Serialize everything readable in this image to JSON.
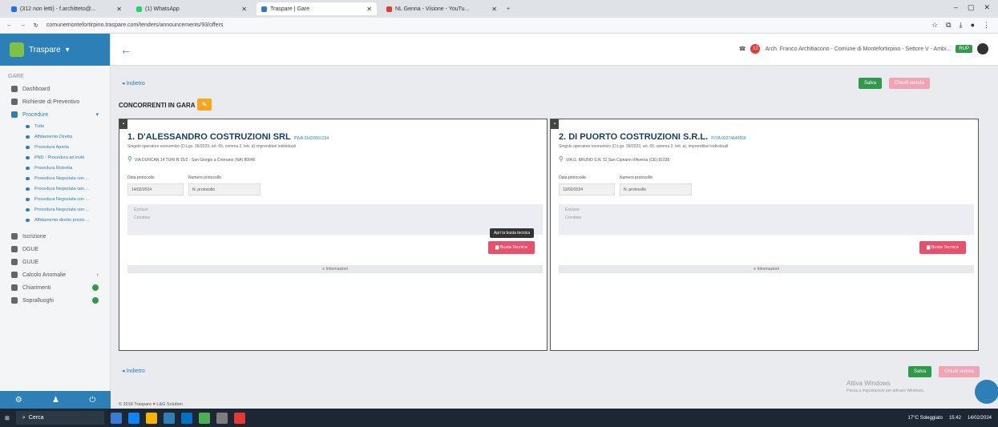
{
  "browser": {
    "tabs": [
      {
        "title": "(312 non letti) - f.architteto@..."
      },
      {
        "title": "(1) WhatsApp"
      },
      {
        "title": "Traspare | Gare"
      },
      {
        "title": "NL Genna - Visione - YouTu..."
      }
    ],
    "url": "comunemontefortirpino.traspare.com/tenders/announcements/93/offers",
    "window_controls": [
      "–",
      "▢",
      "✕"
    ]
  },
  "sidebar": {
    "brand": "Traspare",
    "section_label": "GARE",
    "items": [
      {
        "label": "Dashboard",
        "icon": "dashboard-icon"
      },
      {
        "label": "Richieste di Preventivo",
        "icon": "send-icon"
      },
      {
        "label": "Procedure",
        "icon": "procedure-icon",
        "open": true
      }
    ],
    "sub_items": [
      "Tutte",
      "Affidamento Diretto",
      "Procedura Aperta",
      "PND - Procedura ad inviti",
      "Procedura Ristretta",
      "Procedura Negoziata con ...",
      "Procedura Negoziata con ...",
      "Procedura Negoziata con ...",
      "Procedura Negoziata con ...",
      "Affidamento diretto previo ..."
    ],
    "items_lower": [
      {
        "label": "Iscrizione",
        "icon": "gear-icon"
      },
      {
        "label": "DGUE",
        "icon": "document-icon"
      },
      {
        "label": "GUUE",
        "icon": "megaphone-icon"
      },
      {
        "label": "Calcolo Anomalie",
        "icon": "calculator-icon",
        "arrow": "›"
      },
      {
        "label": "Chiarimenti",
        "icon": "info-icon",
        "badge": true
      },
      {
        "label": "Sopralluoghi",
        "icon": "eye-icon",
        "badge": true
      }
    ]
  },
  "topbar": {
    "notifications": "12",
    "user_info": "Arch. Franco Architiacono - Comune di Montefortirpino - Settore V - Ambi...",
    "role": "RUP"
  },
  "main": {
    "back_label": "◂ Indietro",
    "save_label": "Salva",
    "close_label": "Chiudi seduta",
    "section_title": "CONCORRENTI IN GARA",
    "footer_text": "© 2018 Traspare",
    "footer_suffix": "L&G Solution"
  },
  "competitors": [
    {
      "name": "1. D'ALESSANDRO COSTRUZIONI SRL",
      "piva": "P.IVA 01420061234",
      "type": "Singolo operatore economico (D.Lgs. 36/2023, art. 65, comma 2, lett. a) imprenditori individuali",
      "address": "VIA DUNCAN 14 TURI N 15/2 - San Giorgio a Cremano (NA) 80046",
      "date_label": "Data protocollo",
      "date_value": "14/02/2024",
      "protocol_label": "Numero protocollo",
      "protocol_placeholder": "N. protocollo",
      "status_lines": [
        "Escluso",
        "Cronttiva"
      ],
      "tooltip": "Apri la busta tecnica",
      "busta_label": "Busta Tecnica",
      "info_label": "Informazioni"
    },
    {
      "name": "2. DI PUORTO COSTRUZIONI S.R.L.",
      "piva": "P.IVA 00274640658",
      "type": "Singolo operatore economico (D.Lgs. 36/2023, art. 65, comma 2, lett. a), imprenditori individuali",
      "address": "VIA G. BRUNO S.N. 11 San Cipriano d'Aversa (CE) 81036",
      "date_label": "Data protocollo",
      "date_value": "13/02/2024",
      "protocol_label": "Numero protocollo",
      "protocol_placeholder": "N. protocollo",
      "status_lines": [
        "Escluso",
        "Cronttiva"
      ],
      "busta_label": "Busta Tecnica",
      "info_label": "Informazioni"
    }
  ],
  "watermark": {
    "title": "Attiva Windows",
    "subtitle": "Passa a Impostazioni per attivare Windows."
  },
  "taskbar": {
    "search_label": "Cerca",
    "weather": "17°C Soleggiato",
    "time": "15:42",
    "date": "14/02/2024"
  }
}
